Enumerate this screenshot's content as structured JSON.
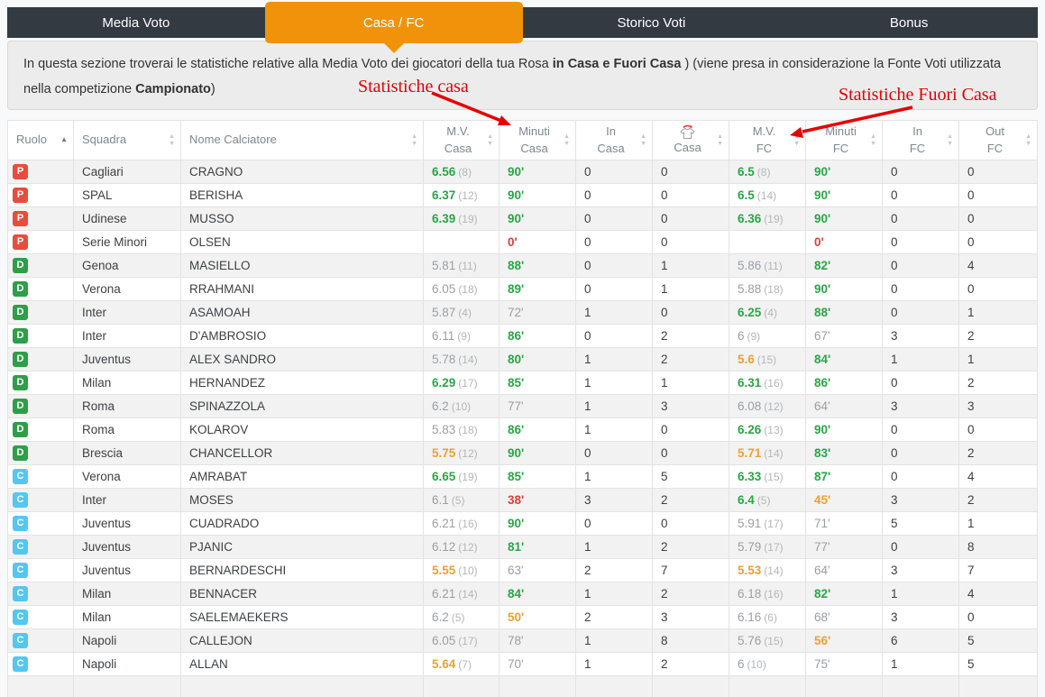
{
  "palette": {
    "tabbar_bg": "#333a42",
    "tab_active_bg": "#f0930a",
    "tab_text": "#ffffff",
    "desc_bg": "#ececec",
    "green": "#28a745",
    "orange": "#f0a030",
    "red": "#d9403a",
    "gray_value": "#9a9fa4",
    "count_gray": "#b2b6ba",
    "role_p": "#e74c3c",
    "role_d": "#2f9e48",
    "role_c": "#54c6f0",
    "annotation_red": "#e60000"
  },
  "tabs": [
    {
      "label": "Media Voto",
      "active": false
    },
    {
      "label": "Casa / FC",
      "active": true
    },
    {
      "label": "Storico Voti",
      "active": false
    },
    {
      "label": "Bonus",
      "active": false
    }
  ],
  "description": {
    "seg1": "In questa sezione troverai le statistiche relative alla Media Voto dei giocatori della tua Rosa ",
    "seg2_bold": "in Casa e Fuori Casa",
    "seg3": " ) (viene presa in considerazione la Fonte Voti utilizzata nella competizione ",
    "seg4_bold": "Campionato",
    "seg5": ")"
  },
  "annotations": {
    "casa_label": "Statistiche casa",
    "fuori_label": "Statistiche Fuori Casa"
  },
  "table": {
    "headers": [
      {
        "id": "ruolo",
        "l1": "Ruolo",
        "l2": "",
        "sort": "asc",
        "align": "left"
      },
      {
        "id": "squadra",
        "l1": "Squadra",
        "l2": "",
        "sort": "both",
        "align": "left"
      },
      {
        "id": "nome-calciatore",
        "l1": "Nome Calciatore",
        "l2": "",
        "sort": "both",
        "align": "left"
      },
      {
        "id": "mv-casa",
        "l1": "M.V.",
        "l2": "Casa",
        "sort": "both",
        "align": "center"
      },
      {
        "id": "minuti-casa",
        "l1": "Minuti",
        "l2": "Casa",
        "sort": "both",
        "align": "center"
      },
      {
        "id": "in-casa",
        "l1": "In",
        "l2": "Casa",
        "sort": "both",
        "align": "center"
      },
      {
        "id": "out-casa",
        "l1": "",
        "l2": "Casa",
        "sort": "both",
        "align": "center",
        "icon": "jersey-out-icon"
      },
      {
        "id": "mv-fc",
        "l1": "M.V.",
        "l2": "FC",
        "sort": "both",
        "align": "center"
      },
      {
        "id": "minuti-fc",
        "l1": "Minuti",
        "l2": "FC",
        "sort": "both",
        "align": "center"
      },
      {
        "id": "in-fc",
        "l1": "In",
        "l2": "FC",
        "sort": "both",
        "align": "center"
      },
      {
        "id": "out-fc",
        "l1": "Out",
        "l2": "FC",
        "sort": "both",
        "align": "center"
      }
    ],
    "rows": [
      {
        "role": "P",
        "team": "Cagliari",
        "name": "CRAGNO",
        "mv_casa": {
          "v": "6.56",
          "n": "(8)",
          "c": "g"
        },
        "min_casa": {
          "v": "90'",
          "c": "g"
        },
        "in_casa": "0",
        "out_casa": "0",
        "mv_fc": {
          "v": "6.5",
          "n": "(8)",
          "c": "g"
        },
        "min_fc": {
          "v": "90'",
          "c": "g"
        },
        "in_fc": "0",
        "out_fc": "0"
      },
      {
        "role": "P",
        "team": "SPAL",
        "name": "BERISHA",
        "mv_casa": {
          "v": "6.37",
          "n": "(12)",
          "c": "g"
        },
        "min_casa": {
          "v": "90'",
          "c": "g"
        },
        "in_casa": "0",
        "out_casa": "0",
        "mv_fc": {
          "v": "6.5",
          "n": "(14)",
          "c": "g"
        },
        "min_fc": {
          "v": "90'",
          "c": "g"
        },
        "in_fc": "0",
        "out_fc": "0"
      },
      {
        "role": "P",
        "team": "Udinese",
        "name": "MUSSO",
        "mv_casa": {
          "v": "6.39",
          "n": "(19)",
          "c": "g"
        },
        "min_casa": {
          "v": "90'",
          "c": "g"
        },
        "in_casa": "0",
        "out_casa": "0",
        "mv_fc": {
          "v": "6.36",
          "n": "(19)",
          "c": "g"
        },
        "min_fc": {
          "v": "90'",
          "c": "g"
        },
        "in_fc": "0",
        "out_fc": "0"
      },
      {
        "role": "P",
        "team": "Serie Minori",
        "name": "OLSEN",
        "mv_casa": {
          "v": "",
          "n": "",
          "c": "n"
        },
        "min_casa": {
          "v": "0'",
          "c": "r"
        },
        "in_casa": "0",
        "out_casa": "0",
        "mv_fc": {
          "v": "",
          "n": "",
          "c": "n"
        },
        "min_fc": {
          "v": "0'",
          "c": "r"
        },
        "in_fc": "0",
        "out_fc": "0"
      },
      {
        "role": "D",
        "team": "Genoa",
        "name": "MASIELLO",
        "mv_casa": {
          "v": "5.81",
          "n": "(11)",
          "c": "n"
        },
        "min_casa": {
          "v": "88'",
          "c": "g"
        },
        "in_casa": "0",
        "out_casa": "1",
        "mv_fc": {
          "v": "5.86",
          "n": "(11)",
          "c": "n"
        },
        "min_fc": {
          "v": "82'",
          "c": "g"
        },
        "in_fc": "0",
        "out_fc": "4"
      },
      {
        "role": "D",
        "team": "Verona",
        "name": "RRAHMANI",
        "mv_casa": {
          "v": "6.05",
          "n": "(18)",
          "c": "n"
        },
        "min_casa": {
          "v": "89'",
          "c": "g"
        },
        "in_casa": "0",
        "out_casa": "1",
        "mv_fc": {
          "v": "5.88",
          "n": "(18)",
          "c": "n"
        },
        "min_fc": {
          "v": "90'",
          "c": "g"
        },
        "in_fc": "0",
        "out_fc": "0"
      },
      {
        "role": "D",
        "team": "Inter",
        "name": "ASAMOAH",
        "mv_casa": {
          "v": "5.87",
          "n": "(4)",
          "c": "n"
        },
        "min_casa": {
          "v": "72'",
          "c": "n"
        },
        "in_casa": "1",
        "out_casa": "0",
        "mv_fc": {
          "v": "6.25",
          "n": "(4)",
          "c": "g"
        },
        "min_fc": {
          "v": "88'",
          "c": "g"
        },
        "in_fc": "0",
        "out_fc": "1"
      },
      {
        "role": "D",
        "team": "Inter",
        "name": "D'AMBROSIO",
        "mv_casa": {
          "v": "6.11",
          "n": "(9)",
          "c": "n"
        },
        "min_casa": {
          "v": "86'",
          "c": "g"
        },
        "in_casa": "0",
        "out_casa": "2",
        "mv_fc": {
          "v": "6",
          "n": "(9)",
          "c": "n"
        },
        "min_fc": {
          "v": "67'",
          "c": "n"
        },
        "in_fc": "3",
        "out_fc": "2"
      },
      {
        "role": "D",
        "team": "Juventus",
        "name": "ALEX SANDRO",
        "mv_casa": {
          "v": "5.78",
          "n": "(14)",
          "c": "n"
        },
        "min_casa": {
          "v": "80'",
          "c": "g"
        },
        "in_casa": "1",
        "out_casa": "2",
        "mv_fc": {
          "v": "5.6",
          "n": "(15)",
          "c": "o"
        },
        "min_fc": {
          "v": "84'",
          "c": "g"
        },
        "in_fc": "1",
        "out_fc": "1"
      },
      {
        "role": "D",
        "team": "Milan",
        "name": "HERNANDEZ",
        "mv_casa": {
          "v": "6.29",
          "n": "(17)",
          "c": "g"
        },
        "min_casa": {
          "v": "85'",
          "c": "g"
        },
        "in_casa": "1",
        "out_casa": "1",
        "mv_fc": {
          "v": "6.31",
          "n": "(16)",
          "c": "g"
        },
        "min_fc": {
          "v": "86'",
          "c": "g"
        },
        "in_fc": "0",
        "out_fc": "2"
      },
      {
        "role": "D",
        "team": "Roma",
        "name": "SPINAZZOLA",
        "mv_casa": {
          "v": "6.2",
          "n": "(10)",
          "c": "n"
        },
        "min_casa": {
          "v": "77'",
          "c": "n"
        },
        "in_casa": "1",
        "out_casa": "3",
        "mv_fc": {
          "v": "6.08",
          "n": "(12)",
          "c": "n"
        },
        "min_fc": {
          "v": "64'",
          "c": "n"
        },
        "in_fc": "3",
        "out_fc": "3"
      },
      {
        "role": "D",
        "team": "Roma",
        "name": "KOLAROV",
        "mv_casa": {
          "v": "5.83",
          "n": "(18)",
          "c": "n"
        },
        "min_casa": {
          "v": "86'",
          "c": "g"
        },
        "in_casa": "1",
        "out_casa": "0",
        "mv_fc": {
          "v": "6.26",
          "n": "(13)",
          "c": "g"
        },
        "min_fc": {
          "v": "90'",
          "c": "g"
        },
        "in_fc": "0",
        "out_fc": "0"
      },
      {
        "role": "D",
        "team": "Brescia",
        "name": "CHANCELLOR",
        "mv_casa": {
          "v": "5.75",
          "n": "(12)",
          "c": "o"
        },
        "min_casa": {
          "v": "90'",
          "c": "g"
        },
        "in_casa": "0",
        "out_casa": "0",
        "mv_fc": {
          "v": "5.71",
          "n": "(14)",
          "c": "o"
        },
        "min_fc": {
          "v": "83'",
          "c": "g"
        },
        "in_fc": "0",
        "out_fc": "2"
      },
      {
        "role": "C",
        "team": "Verona",
        "name": "AMRABAT",
        "mv_casa": {
          "v": "6.65",
          "n": "(19)",
          "c": "g"
        },
        "min_casa": {
          "v": "85'",
          "c": "g"
        },
        "in_casa": "1",
        "out_casa": "5",
        "mv_fc": {
          "v": "6.33",
          "n": "(15)",
          "c": "g"
        },
        "min_fc": {
          "v": "87'",
          "c": "g"
        },
        "in_fc": "0",
        "out_fc": "4"
      },
      {
        "role": "C",
        "team": "Inter",
        "name": "MOSES",
        "mv_casa": {
          "v": "6.1",
          "n": "(5)",
          "c": "n"
        },
        "min_casa": {
          "v": "38'",
          "c": "r"
        },
        "in_casa": "3",
        "out_casa": "2",
        "mv_fc": {
          "v": "6.4",
          "n": "(5)",
          "c": "g"
        },
        "min_fc": {
          "v": "45'",
          "c": "o"
        },
        "in_fc": "3",
        "out_fc": "2"
      },
      {
        "role": "C",
        "team": "Juventus",
        "name": "CUADRADO",
        "mv_casa": {
          "v": "6.21",
          "n": "(16)",
          "c": "n"
        },
        "min_casa": {
          "v": "90'",
          "c": "g"
        },
        "in_casa": "0",
        "out_casa": "0",
        "mv_fc": {
          "v": "5.91",
          "n": "(17)",
          "c": "n"
        },
        "min_fc": {
          "v": "71'",
          "c": "n"
        },
        "in_fc": "5",
        "out_fc": "1"
      },
      {
        "role": "C",
        "team": "Juventus",
        "name": "PJANIC",
        "mv_casa": {
          "v": "6.12",
          "n": "(12)",
          "c": "n"
        },
        "min_casa": {
          "v": "81'",
          "c": "g"
        },
        "in_casa": "1",
        "out_casa": "2",
        "mv_fc": {
          "v": "5.79",
          "n": "(17)",
          "c": "n"
        },
        "min_fc": {
          "v": "77'",
          "c": "n"
        },
        "in_fc": "0",
        "out_fc": "8"
      },
      {
        "role": "C",
        "team": "Juventus",
        "name": "BERNARDESCHI",
        "mv_casa": {
          "v": "5.55",
          "n": "(10)",
          "c": "o"
        },
        "min_casa": {
          "v": "63'",
          "c": "n"
        },
        "in_casa": "2",
        "out_casa": "7",
        "mv_fc": {
          "v": "5.53",
          "n": "(14)",
          "c": "o"
        },
        "min_fc": {
          "v": "64'",
          "c": "n"
        },
        "in_fc": "3",
        "out_fc": "7"
      },
      {
        "role": "C",
        "team": "Milan",
        "name": "BENNACER",
        "mv_casa": {
          "v": "6.21",
          "n": "(14)",
          "c": "n"
        },
        "min_casa": {
          "v": "84'",
          "c": "g"
        },
        "in_casa": "1",
        "out_casa": "2",
        "mv_fc": {
          "v": "6.18",
          "n": "(16)",
          "c": "n"
        },
        "min_fc": {
          "v": "82'",
          "c": "g"
        },
        "in_fc": "1",
        "out_fc": "4"
      },
      {
        "role": "C",
        "team": "Milan",
        "name": "SAELEMAEKERS",
        "mv_casa": {
          "v": "6.2",
          "n": "(5)",
          "c": "n"
        },
        "min_casa": {
          "v": "50'",
          "c": "o"
        },
        "in_casa": "2",
        "out_casa": "3",
        "mv_fc": {
          "v": "6.16",
          "n": "(6)",
          "c": "n"
        },
        "min_fc": {
          "v": "68'",
          "c": "n"
        },
        "in_fc": "3",
        "out_fc": "0"
      },
      {
        "role": "C",
        "team": "Napoli",
        "name": "CALLEJON",
        "mv_casa": {
          "v": "6.05",
          "n": "(17)",
          "c": "n"
        },
        "min_casa": {
          "v": "78'",
          "c": "n"
        },
        "in_casa": "1",
        "out_casa": "8",
        "mv_fc": {
          "v": "5.76",
          "n": "(15)",
          "c": "n"
        },
        "min_fc": {
          "v": "56'",
          "c": "o"
        },
        "in_fc": "6",
        "out_fc": "5"
      },
      {
        "role": "C",
        "team": "Napoli",
        "name": "ALLAN",
        "mv_casa": {
          "v": "5.64",
          "n": "(7)",
          "c": "o"
        },
        "min_casa": {
          "v": "70'",
          "c": "n"
        },
        "in_casa": "1",
        "out_casa": "2",
        "mv_fc": {
          "v": "6",
          "n": "(10)",
          "c": "n"
        },
        "min_fc": {
          "v": "75'",
          "c": "n"
        },
        "in_fc": "1",
        "out_fc": "5"
      }
    ]
  }
}
